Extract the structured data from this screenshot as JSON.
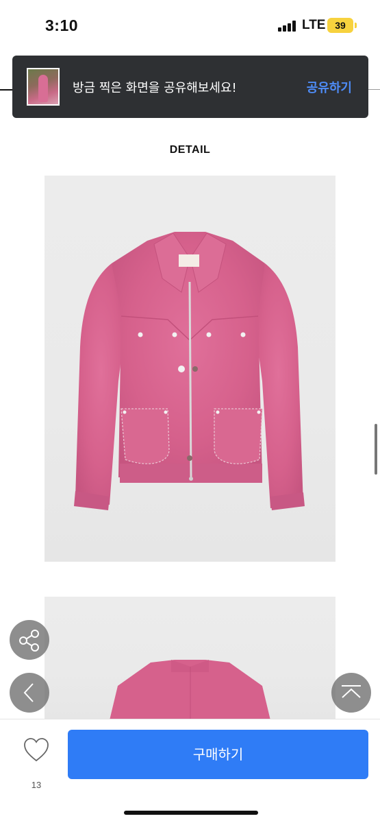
{
  "status_bar": {
    "time": "3:10",
    "network": "LTE",
    "battery": "39"
  },
  "share_toast": {
    "message": "방금 찍은 화면을 공유해보세요!",
    "action_label": "공유하기"
  },
  "detail": {
    "title": "DETAIL",
    "images": [
      {
        "alt": "pink suede zip jacket front"
      },
      {
        "alt": "pink suede zip jacket back"
      }
    ]
  },
  "floating_buttons": {
    "share_icon": "share-icon",
    "back_icon": "chevron-left-icon",
    "top_icon": "scroll-top-icon"
  },
  "bottom_bar": {
    "like_count": "13",
    "buy_label": "구매하기"
  },
  "colors": {
    "accent": "#2f7cf6",
    "toast_bg": "#2e3033",
    "toast_action": "#4e8cf7",
    "jacket_pink": "#d9628f"
  }
}
